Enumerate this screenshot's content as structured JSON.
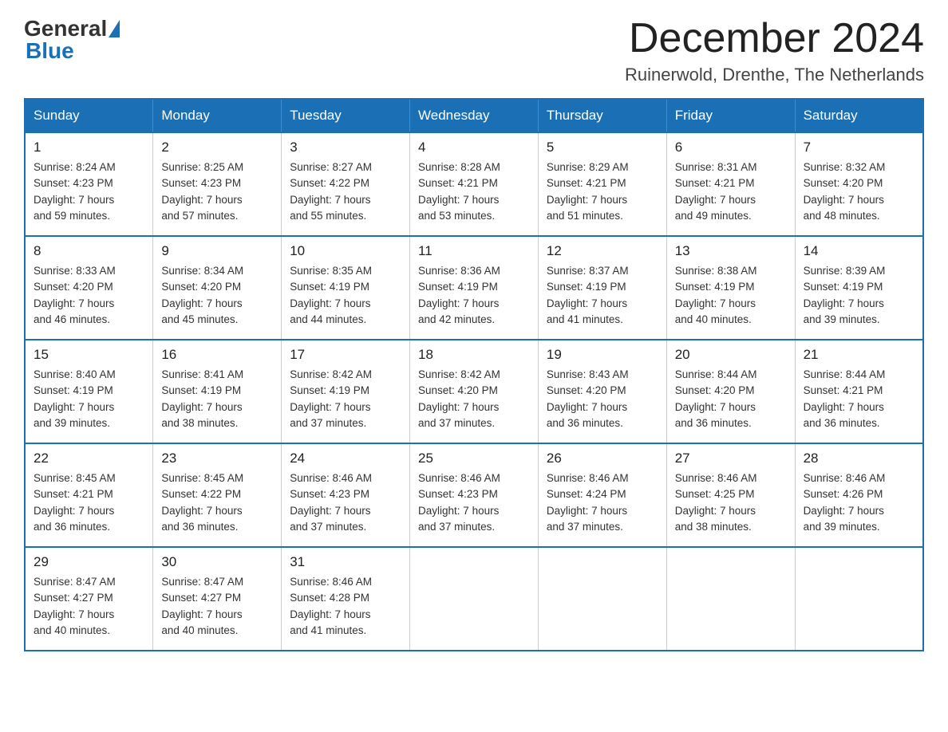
{
  "logo": {
    "general": "General",
    "blue": "Blue"
  },
  "header": {
    "month": "December 2024",
    "location": "Ruinerwold, Drenthe, The Netherlands"
  },
  "weekdays": [
    "Sunday",
    "Monday",
    "Tuesday",
    "Wednesday",
    "Thursday",
    "Friday",
    "Saturday"
  ],
  "weeks": [
    [
      {
        "day": 1,
        "sunrise": "8:24 AM",
        "sunset": "4:23 PM",
        "daylight": "7 hours and 59 minutes."
      },
      {
        "day": 2,
        "sunrise": "8:25 AM",
        "sunset": "4:23 PM",
        "daylight": "7 hours and 57 minutes."
      },
      {
        "day": 3,
        "sunrise": "8:27 AM",
        "sunset": "4:22 PM",
        "daylight": "7 hours and 55 minutes."
      },
      {
        "day": 4,
        "sunrise": "8:28 AM",
        "sunset": "4:21 PM",
        "daylight": "7 hours and 53 minutes."
      },
      {
        "day": 5,
        "sunrise": "8:29 AM",
        "sunset": "4:21 PM",
        "daylight": "7 hours and 51 minutes."
      },
      {
        "day": 6,
        "sunrise": "8:31 AM",
        "sunset": "4:21 PM",
        "daylight": "7 hours and 49 minutes."
      },
      {
        "day": 7,
        "sunrise": "8:32 AM",
        "sunset": "4:20 PM",
        "daylight": "7 hours and 48 minutes."
      }
    ],
    [
      {
        "day": 8,
        "sunrise": "8:33 AM",
        "sunset": "4:20 PM",
        "daylight": "7 hours and 46 minutes."
      },
      {
        "day": 9,
        "sunrise": "8:34 AM",
        "sunset": "4:20 PM",
        "daylight": "7 hours and 45 minutes."
      },
      {
        "day": 10,
        "sunrise": "8:35 AM",
        "sunset": "4:19 PM",
        "daylight": "7 hours and 44 minutes."
      },
      {
        "day": 11,
        "sunrise": "8:36 AM",
        "sunset": "4:19 PM",
        "daylight": "7 hours and 42 minutes."
      },
      {
        "day": 12,
        "sunrise": "8:37 AM",
        "sunset": "4:19 PM",
        "daylight": "7 hours and 41 minutes."
      },
      {
        "day": 13,
        "sunrise": "8:38 AM",
        "sunset": "4:19 PM",
        "daylight": "7 hours and 40 minutes."
      },
      {
        "day": 14,
        "sunrise": "8:39 AM",
        "sunset": "4:19 PM",
        "daylight": "7 hours and 39 minutes."
      }
    ],
    [
      {
        "day": 15,
        "sunrise": "8:40 AM",
        "sunset": "4:19 PM",
        "daylight": "7 hours and 39 minutes."
      },
      {
        "day": 16,
        "sunrise": "8:41 AM",
        "sunset": "4:19 PM",
        "daylight": "7 hours and 38 minutes."
      },
      {
        "day": 17,
        "sunrise": "8:42 AM",
        "sunset": "4:19 PM",
        "daylight": "7 hours and 37 minutes."
      },
      {
        "day": 18,
        "sunrise": "8:42 AM",
        "sunset": "4:20 PM",
        "daylight": "7 hours and 37 minutes."
      },
      {
        "day": 19,
        "sunrise": "8:43 AM",
        "sunset": "4:20 PM",
        "daylight": "7 hours and 36 minutes."
      },
      {
        "day": 20,
        "sunrise": "8:44 AM",
        "sunset": "4:20 PM",
        "daylight": "7 hours and 36 minutes."
      },
      {
        "day": 21,
        "sunrise": "8:44 AM",
        "sunset": "4:21 PM",
        "daylight": "7 hours and 36 minutes."
      }
    ],
    [
      {
        "day": 22,
        "sunrise": "8:45 AM",
        "sunset": "4:21 PM",
        "daylight": "7 hours and 36 minutes."
      },
      {
        "day": 23,
        "sunrise": "8:45 AM",
        "sunset": "4:22 PM",
        "daylight": "7 hours and 36 minutes."
      },
      {
        "day": 24,
        "sunrise": "8:46 AM",
        "sunset": "4:23 PM",
        "daylight": "7 hours and 37 minutes."
      },
      {
        "day": 25,
        "sunrise": "8:46 AM",
        "sunset": "4:23 PM",
        "daylight": "7 hours and 37 minutes."
      },
      {
        "day": 26,
        "sunrise": "8:46 AM",
        "sunset": "4:24 PM",
        "daylight": "7 hours and 37 minutes."
      },
      {
        "day": 27,
        "sunrise": "8:46 AM",
        "sunset": "4:25 PM",
        "daylight": "7 hours and 38 minutes."
      },
      {
        "day": 28,
        "sunrise": "8:46 AM",
        "sunset": "4:26 PM",
        "daylight": "7 hours and 39 minutes."
      }
    ],
    [
      {
        "day": 29,
        "sunrise": "8:47 AM",
        "sunset": "4:27 PM",
        "daylight": "7 hours and 40 minutes."
      },
      {
        "day": 30,
        "sunrise": "8:47 AM",
        "sunset": "4:27 PM",
        "daylight": "7 hours and 40 minutes."
      },
      {
        "day": 31,
        "sunrise": "8:46 AM",
        "sunset": "4:28 PM",
        "daylight": "7 hours and 41 minutes."
      },
      null,
      null,
      null,
      null
    ]
  ]
}
